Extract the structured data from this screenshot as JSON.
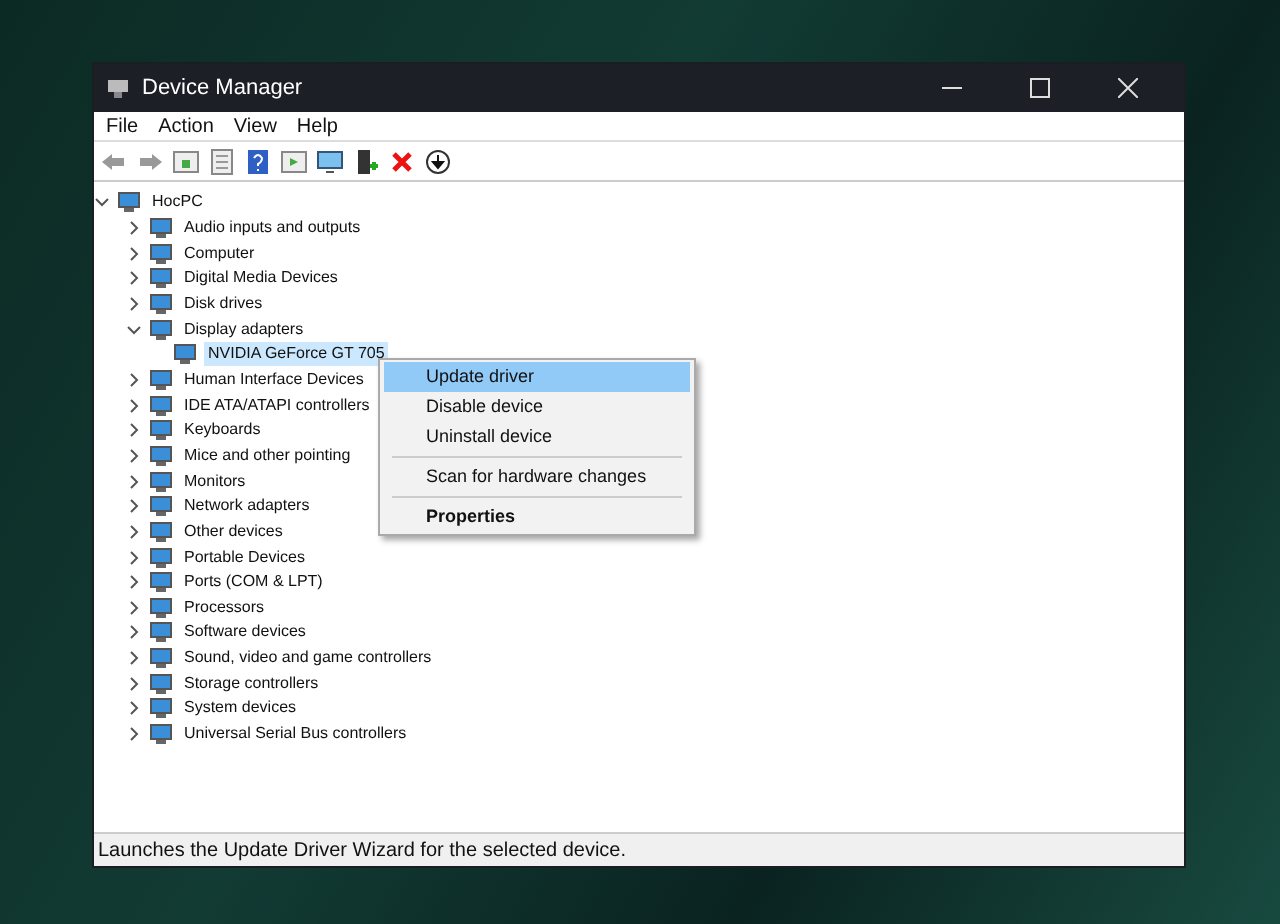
{
  "window": {
    "title": "Device Manager"
  },
  "menu_bar": [
    "File",
    "Action",
    "View",
    "Help"
  ],
  "tree": {
    "label": "HocPC",
    "expanded": true,
    "children": [
      {
        "label": "Audio inputs and outputs",
        "expanded": false,
        "selected": false
      },
      {
        "label": "Computer",
        "expanded": false,
        "selected": false
      },
      {
        "label": "Digital Media Devices",
        "expanded": false,
        "selected": false
      },
      {
        "label": "Disk drives",
        "expanded": false,
        "selected": false
      },
      {
        "label": "Display adapters",
        "expanded": true,
        "selected": false,
        "children": [
          {
            "label": "NVIDIA GeForce GT 705",
            "selected": true
          }
        ]
      },
      {
        "label": "Human Interface Devices",
        "expanded": false,
        "selected": false
      },
      {
        "label": "IDE ATA/ATAPI controllers",
        "expanded": false,
        "selected": false
      },
      {
        "label": "Keyboards",
        "expanded": false,
        "selected": false
      },
      {
        "label": "Mice and other pointing",
        "expanded": false,
        "selected": false
      },
      {
        "label": "Monitors",
        "expanded": false,
        "selected": false
      },
      {
        "label": "Network adapters",
        "expanded": false,
        "selected": false
      },
      {
        "label": "Other devices",
        "expanded": false,
        "selected": false
      },
      {
        "label": "Portable Devices",
        "expanded": false,
        "selected": false
      },
      {
        "label": "Ports (COM & LPT)",
        "expanded": false,
        "selected": false
      },
      {
        "label": "Processors",
        "expanded": false,
        "selected": false
      },
      {
        "label": "Software devices",
        "expanded": false,
        "selected": false
      },
      {
        "label": "Sound, video and game controllers",
        "expanded": false,
        "selected": false
      },
      {
        "label": "Storage controllers",
        "expanded": false,
        "selected": false
      },
      {
        "label": "System devices",
        "expanded": false,
        "selected": false
      },
      {
        "label": "Universal Serial Bus controllers",
        "expanded": false,
        "selected": false
      }
    ]
  },
  "context_menu": [
    {
      "label": "Update driver",
      "selected": true,
      "separator_before": false,
      "default": false
    },
    {
      "label": "Disable device",
      "selected": false,
      "separator_before": false,
      "default": false
    },
    {
      "label": "Uninstall device",
      "selected": false,
      "separator_before": false,
      "default": false
    },
    {
      "label": "Scan for hardware changes",
      "selected": false,
      "separator_before": true,
      "default": false
    },
    {
      "label": "Properties",
      "selected": false,
      "separator_before": true,
      "default": true
    }
  ],
  "status_bar": "Launches the Update Driver Wizard for the selected device."
}
